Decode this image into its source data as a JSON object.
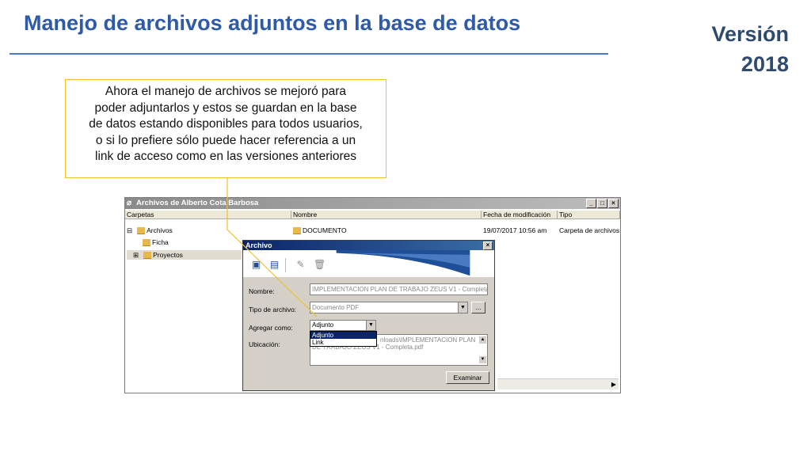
{
  "slide": {
    "title": "Manejo de archivos adjuntos en la base de datos",
    "version_line1": "Versión",
    "version_line2": "2018",
    "callout_lines": [
      "Ahora el manejo de archivos se mejoró para",
      "poder adjuntarlos y estos se guardan en la base",
      "de datos estando disponibles para todos usuarios,",
      "o si lo prefiere sólo puede hacer referencia a un",
      "link de acceso como en las versiones anteriores"
    ]
  },
  "window": {
    "title": "Archivos de Alberto Cota Barbosa",
    "columns": {
      "carpetas": "Carpetas",
      "nombre": "Nombre",
      "fecha": "Fecha de modificación",
      "tipo": "Tipo"
    },
    "tree": [
      {
        "label": "Archivos",
        "expander": "⊟"
      },
      {
        "label": "Ficha",
        "expander": ""
      },
      {
        "label": "Proyectos",
        "expander": "⊞"
      }
    ],
    "files": [
      {
        "nombre": "DOCUMENTO",
        "fecha": "19/07/2017 10:56 am",
        "tipo": "Carpeta de archivos"
      }
    ]
  },
  "dialog": {
    "title": "Archivo",
    "close": "×",
    "nombre_label": "Nombre:",
    "nombre_value": "IMPLEMENTACION PLAN DE TRABAJO ZEUS V1 - Completa",
    "tipo_label": "Tipo de archivo:",
    "tipo_value": "Documento PDF",
    "tipo_more": "...",
    "agregar_label": "Agregar como:",
    "agregar_value": "Adjunto",
    "agregar_options": [
      "Adjunto",
      "Link"
    ],
    "ubicacion_label": "Ubicación:",
    "ubicacion_value_line1": "nloads\\IMPLEMENTACION PLAN",
    "ubicacion_value_line2": "DE TRABAJO ZEUS V1 - Completa.pdf",
    "examinar": "Examinar"
  },
  "colors": {
    "title": "#2e5aa8",
    "rule": "#4a78c8",
    "callout_border": "#f0c030",
    "dialog_title": "#0a246a"
  }
}
